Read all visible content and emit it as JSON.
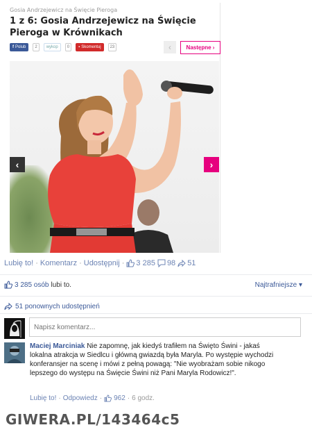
{
  "gallery": {
    "breadcrumb": "Gosia Andrzejewicz na Święcie Pieroga",
    "title": "1 z 6:  Gosia Andrzejewicz na Święcie Pieroga w Krównikach",
    "share": {
      "facebook_label": "Polub",
      "facebook_count": "2",
      "wykop_label": "wykop",
      "wykop_count": "0",
      "comments_label": "Skomentuj",
      "comments_count": "23"
    },
    "prev_label": "‹",
    "next_label": "Następne ›",
    "photo_prev": "‹",
    "photo_next": "›"
  },
  "post_actions": {
    "like": "Lubię to!",
    "comment": "Komentarz",
    "share": "Udostępnij",
    "like_count": "3 285",
    "comment_count": "98",
    "share_count": "51"
  },
  "likes_summary": {
    "count": "3 285 osób",
    "suffix": "lubi to.",
    "sort": "Najtrafniejsze ▾"
  },
  "shares_summary": "51 ponownych udostępnień",
  "comment_input": {
    "placeholder": "Napisz komentarz..."
  },
  "comment": {
    "author": "Maciej Marciniak",
    "text": " Nie zapomnę, jak kiedyś trafiłem na Święto Świni - jakaś lokalna atrakcja w Siedlcu i główną gwiazdą była Maryla. Po występie wychodzi konferansjer na scenę i mówi z pełną powagą: \"Nie wyobrażam sobie nikogo lepszego do występu na Święcie Świni niż Pani Maryla Rodowicz!\".",
    "like": "Lubię to!",
    "reply": "Odpowiedz",
    "likes": "962",
    "time": "6 godz."
  },
  "watermark": "GIWERA.PL/143464c5",
  "colors": {
    "facebook_blue": "#3b5998",
    "link_blue": "#6d84b4",
    "accent_pink": "#e6007e",
    "dress_red": "#e8413a"
  }
}
